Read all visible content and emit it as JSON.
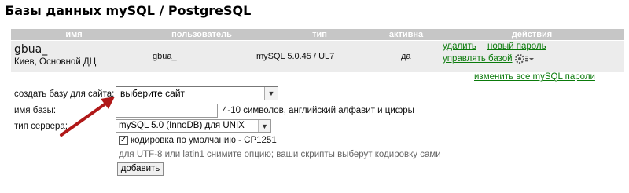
{
  "page_title": "Базы данных mySQL / PostgreSQL",
  "table": {
    "headers": [
      "имя",
      "пользователь",
      "тип",
      "активна",
      "действия"
    ],
    "row": {
      "name": "gbua_",
      "location": "Киев, Основной ДЦ",
      "user": "gbua_",
      "type": "mySQL 5.0.45 / UL7",
      "active": "да",
      "actions": {
        "delete": "удалить",
        "new_password": "новый пароль",
        "manage": "управлять базой"
      }
    },
    "change_all_passwords": "изменить все mySQL пароли"
  },
  "form": {
    "site_label": "создать базу для сайта:",
    "site_select": "выберите сайт",
    "dbname_label": "имя базы:",
    "dbname_value": "",
    "dbname_hint": "4-10 символов, английский алфавит и цифры",
    "server_label": "тип сервера:",
    "server_select": "mySQL 5.0 (InnoDB) для UNIX",
    "charset_checked": true,
    "charset_label": "кодировка по умолчанию - CP1251",
    "charset_note": "для UTF-8 или latin1 снимите опцию; ваши скрипты выберут кодировку сами",
    "submit": "добавить"
  },
  "colors": {
    "link": "#0a7a0a",
    "header_bg": "#c6c6c6",
    "row_bg": "#ececec",
    "arrow": "#b01818"
  },
  "icons": {
    "settings": "gear-icon",
    "dropdown": "chevron-down-icon"
  }
}
